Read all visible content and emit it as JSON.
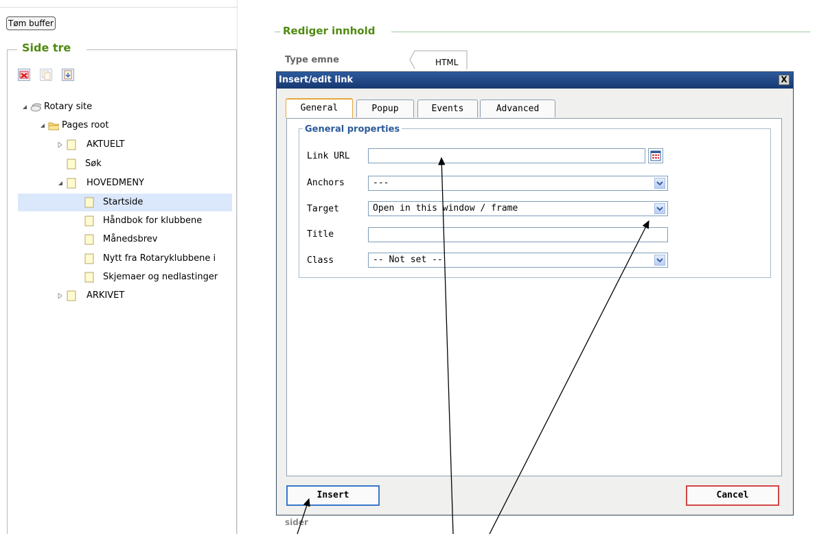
{
  "left_panel": {
    "clear_buffer_button": "Tøm buffer",
    "tree_title": "Side tre",
    "toolbar_icons": [
      "delete-page-icon",
      "copy-page-icon",
      "paste-page-icon"
    ],
    "tree": [
      {
        "label": "Rotary site",
        "icon": "site-icon",
        "expanded": true
      },
      {
        "label": "Pages root",
        "icon": "folder-icon",
        "expanded": true
      },
      {
        "label": "AKTUELT",
        "icon": "page-icon",
        "expanded": false
      },
      {
        "label": "Søk",
        "icon": "page-icon"
      },
      {
        "label": "HOVEDMENY",
        "icon": "page-icon",
        "expanded": true
      },
      {
        "label": "Startside",
        "icon": "page-icon",
        "selected": true
      },
      {
        "label": "Håndbok for klubbene",
        "icon": "page-icon"
      },
      {
        "label": "Månedsbrev",
        "icon": "page-icon"
      },
      {
        "label": "Nytt fra Rotaryklubbene i",
        "icon": "page-icon"
      },
      {
        "label": "Skjemaer og nedlastinger",
        "icon": "page-icon"
      },
      {
        "label": "ARKIVET",
        "icon": "page-icon",
        "expanded": false
      }
    ]
  },
  "editor": {
    "section_title": "Rediger innhold",
    "type_label": "Type emne",
    "type_value": "HTML",
    "bottom_label": "sider"
  },
  "dialog": {
    "title": "Insert/edit link",
    "close_label": "X",
    "tabs": [
      {
        "label": "General",
        "active": true
      },
      {
        "label": "Popup"
      },
      {
        "label": "Events"
      },
      {
        "label": "Advanced"
      }
    ],
    "fieldset_legend": "General properties",
    "fields": {
      "link_url": {
        "label": "Link URL",
        "value": ""
      },
      "anchors": {
        "label": "Anchors",
        "value": "---"
      },
      "target": {
        "label": "Target",
        "value": "Open in this window / frame"
      },
      "title": {
        "label": "Title",
        "value": ""
      },
      "class": {
        "label": "Class",
        "value": "-- Not set --"
      }
    },
    "insert_label": "Insert",
    "cancel_label": "Cancel"
  },
  "colors": {
    "section_title": "#4f8a10",
    "dialog_titlebar": "#1e3f7a",
    "legend": "#2b5a9b",
    "selected_row": "#dbe8fb",
    "active_tab_accent": "#e7a53a",
    "insert_border": "#3877c9",
    "cancel_border": "#d34545"
  }
}
